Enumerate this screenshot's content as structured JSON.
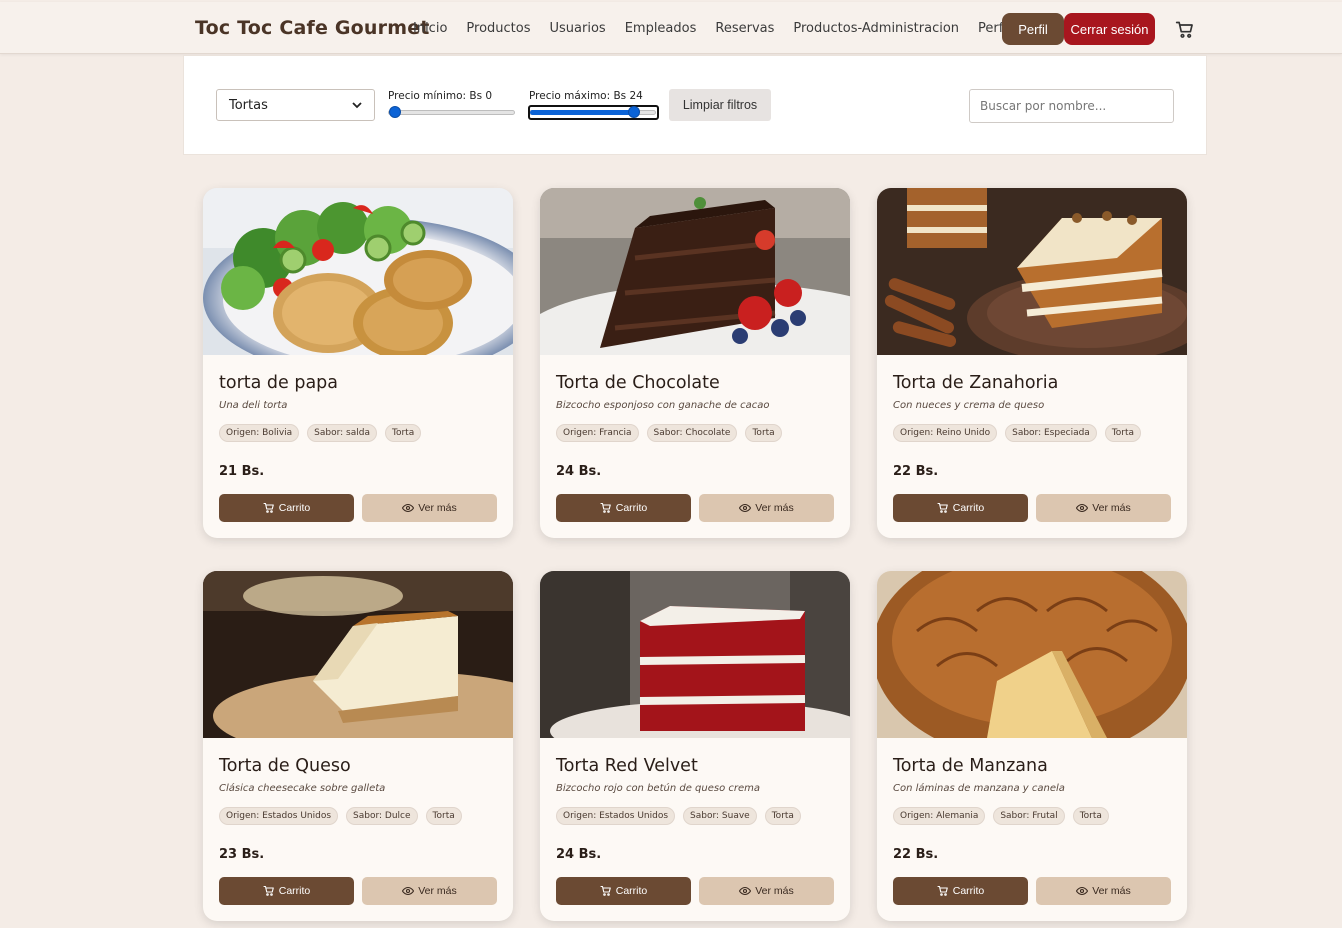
{
  "navbar": {
    "brand": "Toc Toc Cafe Gourmet",
    "links": [
      "Inicio",
      "Productos",
      "Usuarios",
      "Empleados",
      "Reservas",
      "Productos-Administracion",
      "Perfil"
    ],
    "perfil_button": "Perfil",
    "logout_button": "Cerrar sesión",
    "cart_icon": "cart-icon"
  },
  "filters": {
    "category_selected": "Tortas",
    "min_label": "Precio mínimo: Bs 0",
    "min_value": 0,
    "max_label": "Precio máximo: Bs 24",
    "max_value": 24,
    "clear_label": "Limpiar filtros",
    "search_placeholder": "Buscar por nombre..."
  },
  "products": [
    {
      "title": "torta de papa",
      "desc": "Una deli torta",
      "tags": [
        "Origen: Bolivia",
        "Sabor: salda",
        "Torta"
      ],
      "price": "21 Bs.",
      "cart_label": "Carrito",
      "more_label": "Ver más"
    },
    {
      "title": "Torta de Chocolate",
      "desc": "Bizcocho esponjoso con ganache de cacao",
      "tags": [
        "Origen: Francia",
        "Sabor: Chocolate",
        "Torta"
      ],
      "price": "24 Bs.",
      "cart_label": "Carrito",
      "more_label": "Ver más"
    },
    {
      "title": "Torta de Zanahoria",
      "desc": "Con nueces y crema de queso",
      "tags": [
        "Origen: Reino Unido",
        "Sabor: Especiada",
        "Torta"
      ],
      "price": "22 Bs.",
      "cart_label": "Carrito",
      "more_label": "Ver más"
    },
    {
      "title": "Torta de Queso",
      "desc": "Clásica cheesecake sobre galleta",
      "tags": [
        "Origen: Estados Unidos",
        "Sabor: Dulce",
        "Torta"
      ],
      "price": "23 Bs.",
      "cart_label": "Carrito",
      "more_label": "Ver más"
    },
    {
      "title": "Torta Red Velvet",
      "desc": "Bizcocho rojo con betún de queso crema",
      "tags": [
        "Origen: Estados Unidos",
        "Sabor: Suave",
        "Torta"
      ],
      "price": "24 Bs.",
      "cart_label": "Carrito",
      "more_label": "Ver más"
    },
    {
      "title": "Torta de Manzana",
      "desc": "Con láminas de manzana y canela",
      "tags": [
        "Origen: Alemania",
        "Sabor: Frutal",
        "Torta"
      ],
      "price": "22 Bs.",
      "cart_label": "Carrito",
      "more_label": "Ver más"
    }
  ],
  "colors": {
    "brand_brown": "#6b4a33",
    "logout_red": "#a8161e",
    "slider_blue": "#0b63d6",
    "secondary_button": "#dcc6b0",
    "page_bg": "#f4ece6"
  }
}
